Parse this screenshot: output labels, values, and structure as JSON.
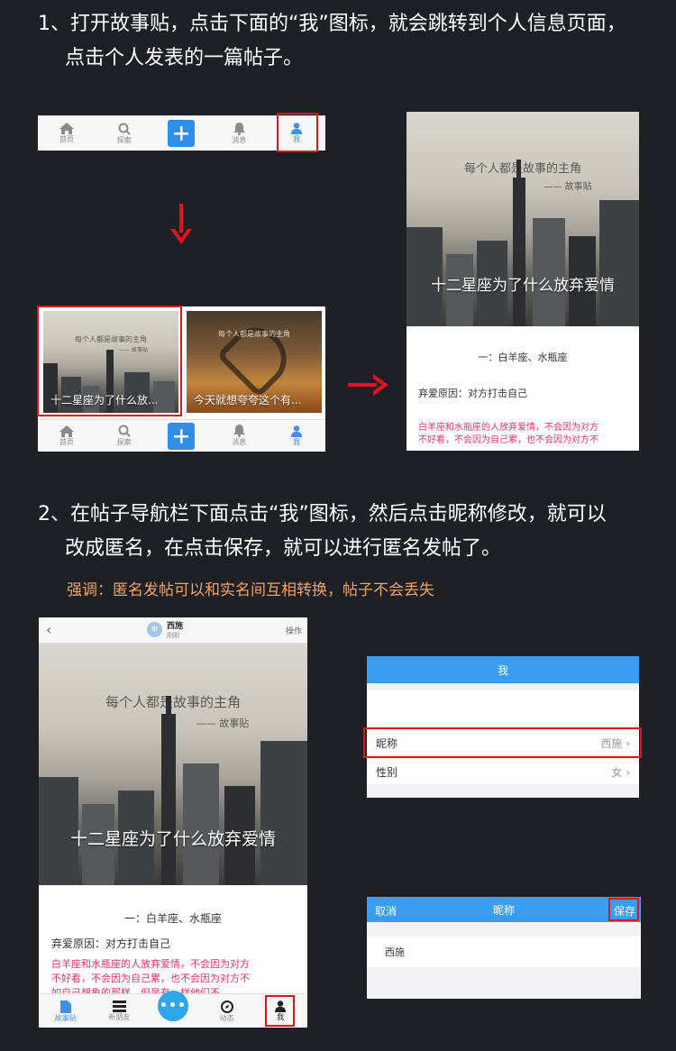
{
  "step1": {
    "line1": "1、打开故事贴，点击下面的“我”图标，就会跳转到个人信息页面，",
    "line2": "点击个人发表的一篇帖子。"
  },
  "step2": {
    "line1": "2、在帖子导航栏下面点击“我”图标，然后点击昵称修改，就可以",
    "line2": "改成匿名，在点击保存，就可以进行匿名发帖了。",
    "emphasis": "强调：匿名发帖可以和实名间互相转换，帖子不会丢失"
  },
  "tabbar": {
    "home": "首页",
    "explore": "探索",
    "messages": "消息",
    "me": "我"
  },
  "cards": {
    "card1_caption": "十二星座为了什么放...",
    "card2_caption": "今天就想夸夸这个有..."
  },
  "post": {
    "quote": "每个人都是故事的主角",
    "quote_author": "—— 故事贴",
    "title": "十二星座为了什么放弃爱情",
    "section": "一：白羊座、水瓶座",
    "reason": "弃爱原因：对方打击自己",
    "pink_line1": "白羊座和水瓶座的人放弃爱情，不会因为对方",
    "pink_line2": "不好看，不会因为自己累，也不会因为对方不",
    "pink_line3": "如自己想象的那样，但是有一样他们不…"
  },
  "post_header": {
    "name": "西施",
    "time": "刚刚",
    "action": "操作"
  },
  "app_tabbar": {
    "gushitie": "故事贴",
    "friends": "新朋友",
    "dynamic": "动态",
    "me": "我"
  },
  "me_screen": {
    "title": "我",
    "nickname_label": "昵称",
    "nickname_value": "西施",
    "gender_label": "性别",
    "gender_value": "女"
  },
  "nick_screen": {
    "cancel": "取消",
    "title": "昵称",
    "save": "保存",
    "value": "西施"
  },
  "colors": {
    "background": "#1e2026",
    "highlight": "#e1141c",
    "accent_blue": "#3b9df2",
    "emphasis": "#f2a35e",
    "pink_text": "#e83068"
  }
}
